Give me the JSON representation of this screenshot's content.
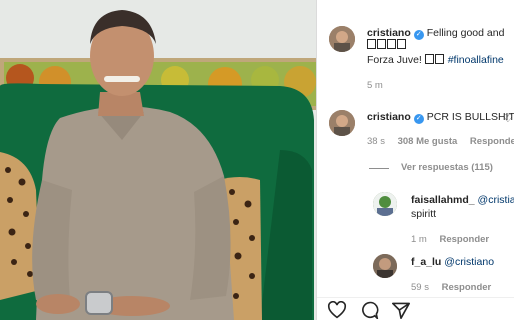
{
  "post": {
    "author": "cristiano",
    "caption_line1": "Felling good and",
    "caption_emoji_boxes": 4,
    "caption_line2": "Forza Juve!",
    "caption_hashtag": "#finoallafine",
    "time": "5 m"
  },
  "comments": [
    {
      "user": "cristiano",
      "verified": true,
      "text": "PCR IS BULLSHIT",
      "time": "38 s",
      "likes": "308 Me gusta",
      "reply": "Responder"
    }
  ],
  "view_replies": "Ver respuestas (115)",
  "replies": [
    {
      "user": "faisallahmd_",
      "mention": "@cristia",
      "text_line2": "spiritt",
      "time": "1 m",
      "reply": "Responder"
    },
    {
      "user": "f_a_lu",
      "mention": "@cristiano",
      "time": "59 s",
      "reply": "Responder"
    }
  ],
  "actions": {
    "like_icon": "heart-outline-icon",
    "comment_icon": "comment-bubble-icon",
    "share_icon": "paper-plane-icon"
  },
  "colors": {
    "link": "#00376b",
    "verified": "#3897f0",
    "muted": "#8e8e8e",
    "sofa": "#0f6b3e"
  }
}
